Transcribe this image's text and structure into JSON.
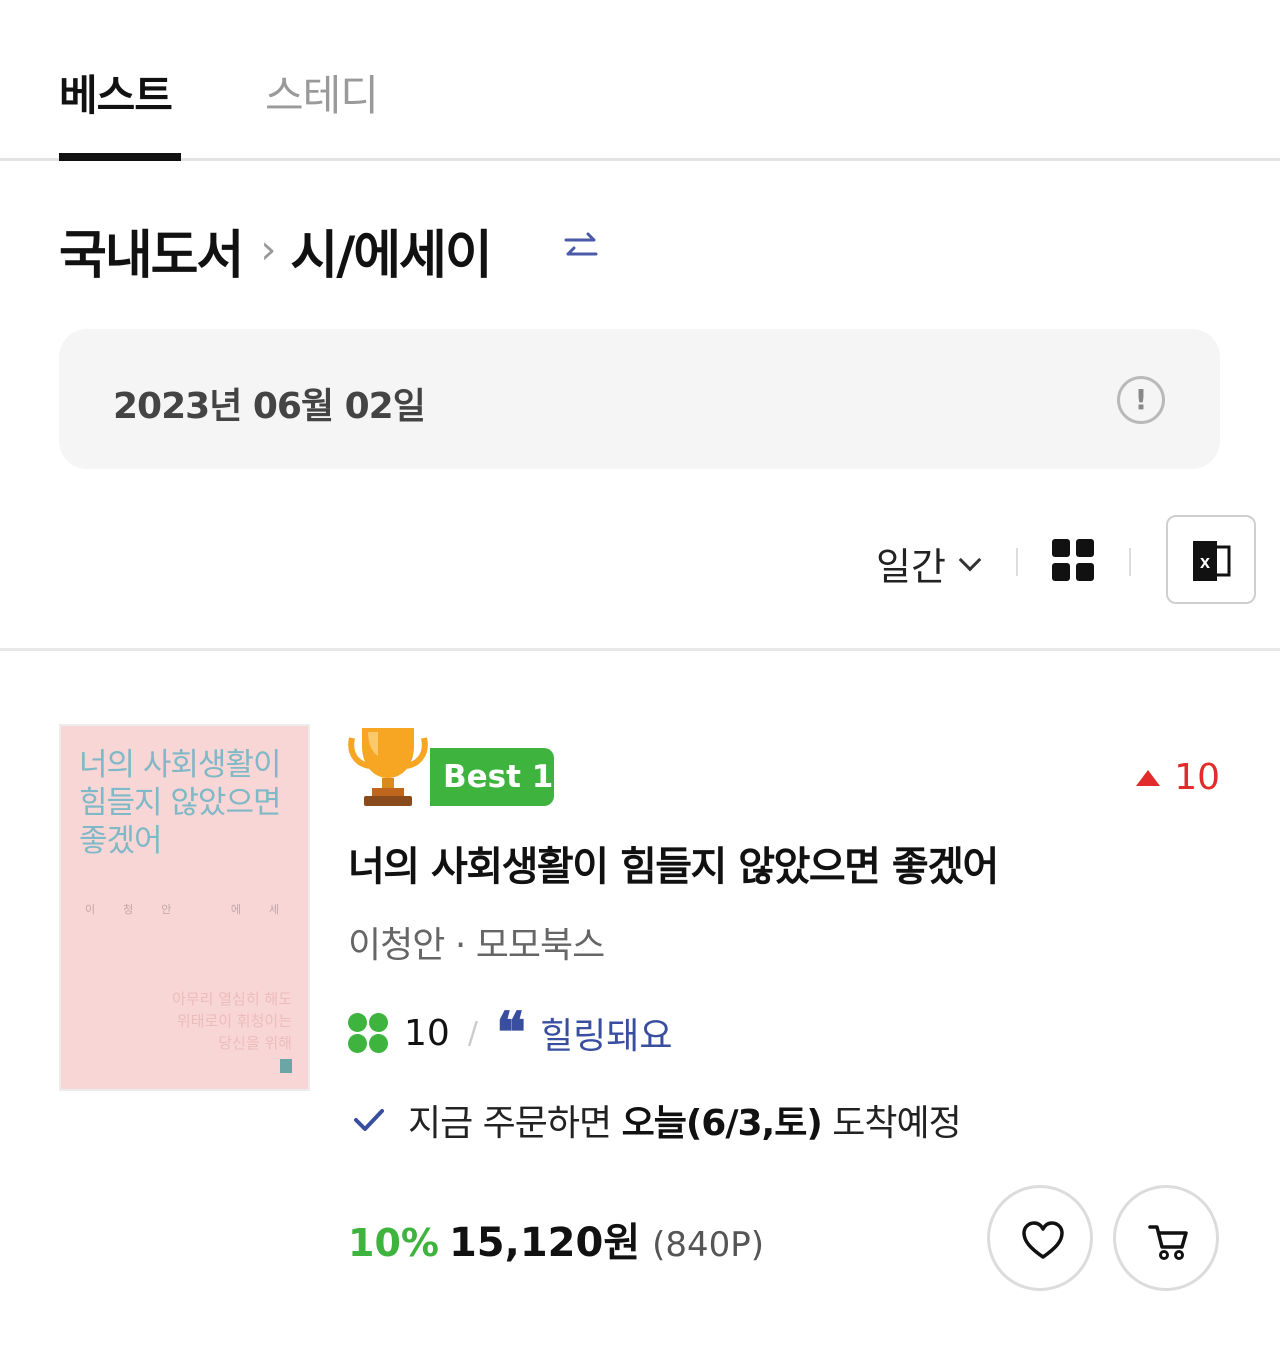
{
  "tabs": [
    {
      "label": "베스트",
      "active": true
    },
    {
      "label": "스테디",
      "active": false
    }
  ],
  "breadcrumb": {
    "level1": "국내도서",
    "separator": "›",
    "level2": "시/에세이"
  },
  "date": {
    "text": "2023년 06월 02일",
    "info_glyph": "!"
  },
  "toolbar": {
    "period_label": "일간",
    "view_icon": "grid-view-icon",
    "export_icon": "excel-icon"
  },
  "book": {
    "cover": {
      "title_lines": [
        "너의 사회생활이",
        "힘들지 않았으면",
        "좋겠어"
      ],
      "author_line": "이청안 에세이",
      "subtitle_lines": [
        "아무리 열심히 해도",
        "위태로이 휘청이는",
        "당신을 위해"
      ]
    },
    "badge": "Best 1",
    "rank_change": "10",
    "title": "너의 사회생활이 힘들지 않았으면 좋겠어",
    "author": "이청안",
    "meta_sep": " · ",
    "publisher": "모모북스",
    "review_count": "10",
    "review_sep": "/",
    "review_quote": "❝",
    "review_tag": "힐링돼요",
    "delivery": {
      "prefix": "지금 주문하면 ",
      "highlight": "오늘(6/3,토)",
      "suffix": " 도착예정"
    },
    "discount": "10%",
    "price": "15,120원",
    "points": "(840P)"
  },
  "colors": {
    "accent_green": "#3eb33e",
    "rank_up_red": "#e22c2c",
    "review_blue": "#3a4ea0",
    "cover_pink": "#f8d6d6"
  }
}
